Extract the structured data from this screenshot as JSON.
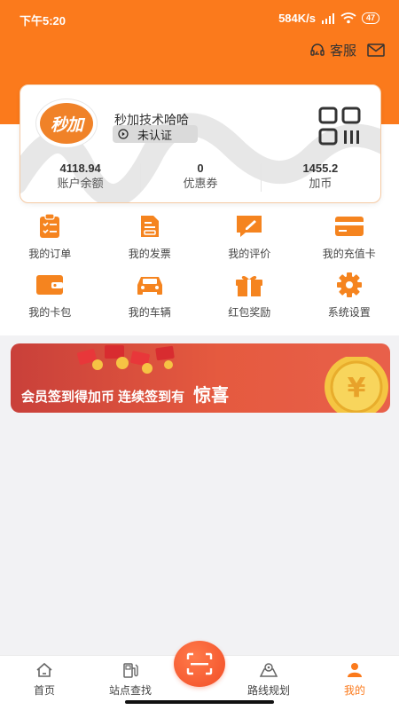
{
  "status_bar": {
    "time": "下午5:20",
    "network_speed": "584K/s",
    "battery": "47"
  },
  "header": {
    "service_label": "客服"
  },
  "profile": {
    "avatar_text": "秒加",
    "username": "秒加技术哈哈",
    "verify_status": "未认证",
    "stats": [
      {
        "value": "4118.94",
        "label": "账户余额"
      },
      {
        "value": "0",
        "label": "优惠券"
      },
      {
        "value": "1455.2",
        "label": "加币"
      }
    ]
  },
  "menu": [
    {
      "label": "我的订单",
      "icon": "clipboard-icon"
    },
    {
      "label": "我的发票",
      "icon": "invoice-icon"
    },
    {
      "label": "我的评价",
      "icon": "comment-icon"
    },
    {
      "label": "我的充值卡",
      "icon": "card-icon"
    },
    {
      "label": "我的卡包",
      "icon": "wallet-icon"
    },
    {
      "label": "我的车辆",
      "icon": "car-icon"
    },
    {
      "label": "红包奖励",
      "icon": "gift-icon"
    },
    {
      "label": "系统设置",
      "icon": "gear-icon"
    }
  ],
  "banner": {
    "text": "会员签到得加币 连续签到有",
    "highlight": "惊喜",
    "coin_symbol": "¥"
  },
  "tabbar": {
    "items": [
      {
        "label": "首页",
        "icon": "home-icon"
      },
      {
        "label": "站点查找",
        "icon": "station-icon"
      },
      {
        "label": "路线规划",
        "icon": "map-icon"
      },
      {
        "label": "我的",
        "icon": "user-icon"
      }
    ],
    "active": "我的"
  },
  "colors": {
    "brand": "#fb7a1c",
    "banner": "#e55a3f",
    "scan": "#f24e27"
  }
}
